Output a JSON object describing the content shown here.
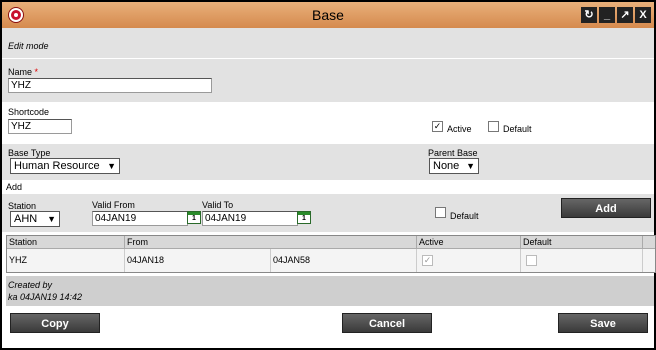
{
  "window": {
    "title": "Base",
    "controls": [
      "restore-icon",
      "minimize-icon",
      "maximize-icon",
      "close-icon"
    ]
  },
  "mode_label": "Edit mode",
  "name": {
    "label": "Name",
    "required_mark": "*",
    "value": "YHZ"
  },
  "shortcode": {
    "label": "Shortcode",
    "value": "YHZ"
  },
  "active": {
    "label": "Active",
    "checked": true
  },
  "default": {
    "label": "Default",
    "checked": false
  },
  "base_type": {
    "label": "Base Type",
    "value": "Human Resource"
  },
  "parent_base": {
    "label": "Parent Base",
    "value": "None"
  },
  "add_section": {
    "title": "Add",
    "station_label": "Station",
    "station_value": "AHN",
    "valid_from_label": "Valid From",
    "valid_from_value": "04JAN19",
    "valid_to_label": "Valid To",
    "valid_to_value": "04JAN19",
    "default_label": "Default",
    "add_button": "Add",
    "calendar_day": "1"
  },
  "grid": {
    "headers": {
      "station": "Station",
      "from": "From",
      "active": "Active",
      "default": "Default"
    },
    "rows": [
      {
        "station": "YHZ",
        "from": "04JAN18",
        "to": "04JAN58",
        "active": true,
        "default": false
      }
    ]
  },
  "created": {
    "label": "Created by",
    "value": "ka 04JAN19 14:42"
  },
  "buttons": {
    "copy": "Copy",
    "cancel": "Cancel",
    "save": "Save"
  },
  "colors": {
    "titlebar": "#dc9a62",
    "button": "#4a4a4a",
    "brand_red": "#c8102e"
  }
}
